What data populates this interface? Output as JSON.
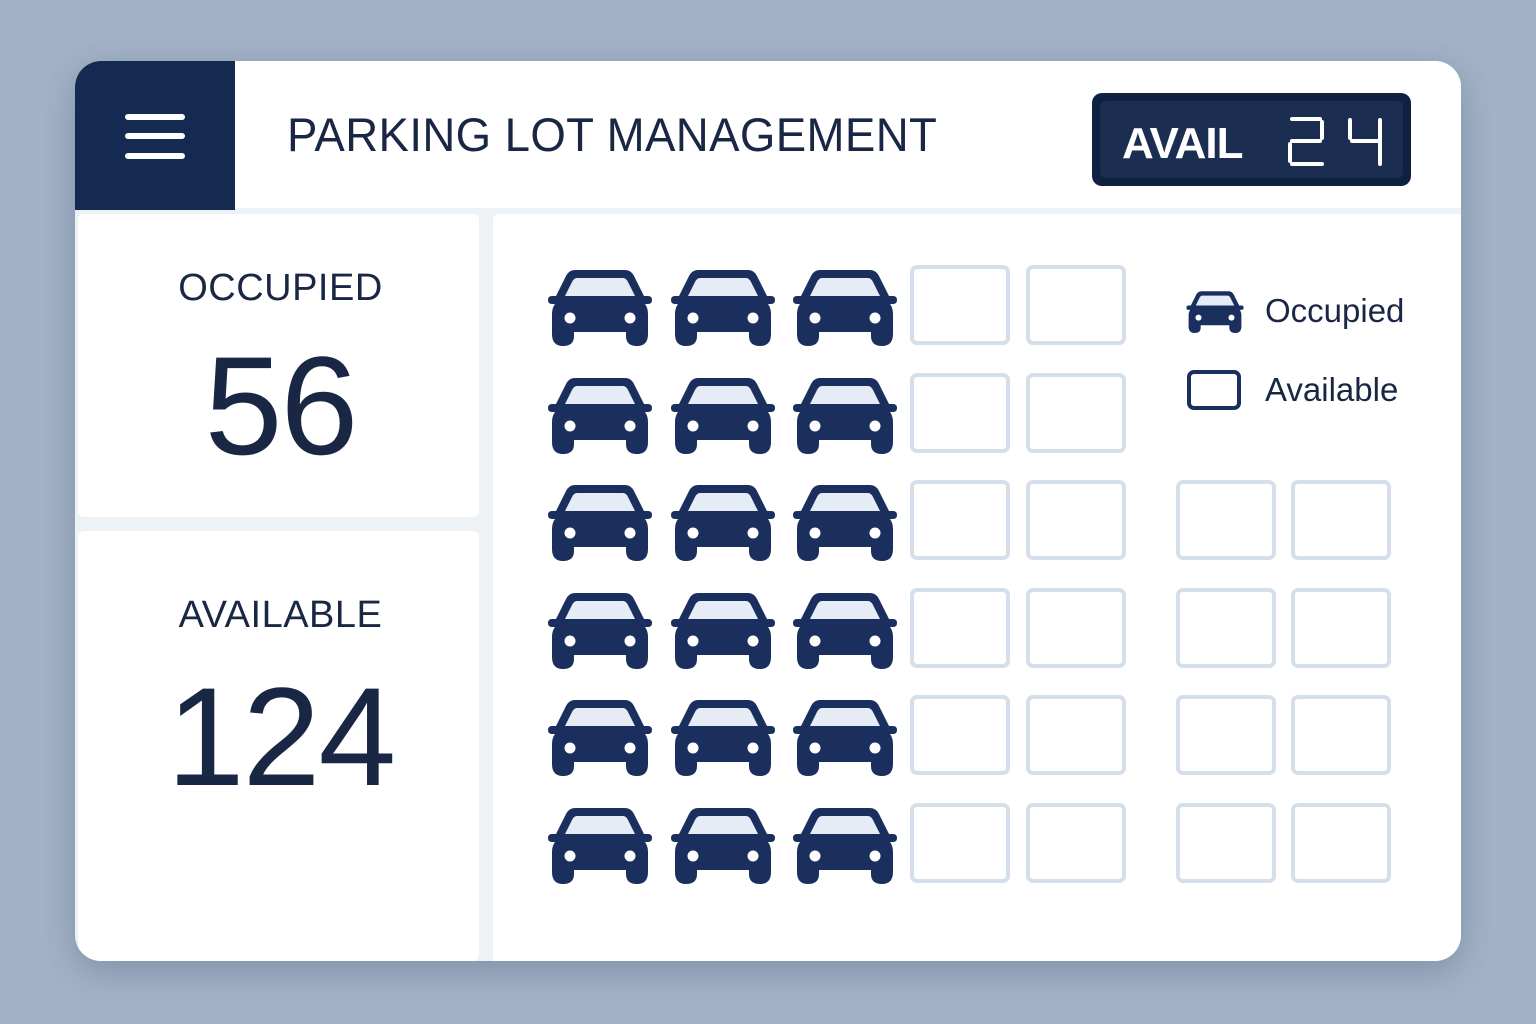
{
  "header": {
    "title": "PARKING LOT MANAGEMENT",
    "avail_label": "AVAIL",
    "avail_digits": "24"
  },
  "stats": {
    "occupied_label": "OCCUPIED",
    "occupied_value": "56",
    "available_label": "AVAILABLE",
    "available_value": "124"
  },
  "legend": {
    "occupied": "Occupied",
    "available": "Available"
  },
  "lot": {
    "rows": [
      [
        "occupied",
        "occupied",
        "occupied",
        "available",
        "available"
      ],
      [
        "occupied",
        "occupied",
        "occupied",
        "available",
        "available"
      ],
      [
        "occupied",
        "occupied",
        "occupied",
        "available",
        "available",
        "available",
        "available"
      ],
      [
        "occupied",
        "occupied",
        "occupied",
        "available",
        "available",
        "available",
        "available"
      ],
      [
        "occupied",
        "occupied",
        "occupied",
        "available",
        "available",
        "available",
        "available"
      ],
      [
        "occupied",
        "occupied",
        "occupied",
        "available",
        "available",
        "available",
        "available"
      ]
    ]
  },
  "colors": {
    "brand_navy": "#142a50",
    "car_fill": "#1a2f5e",
    "car_window": "#e6ecf5",
    "slot_border": "#d5dfec",
    "background": "#a3b2c6"
  },
  "icons": {
    "menu": "hamburger-menu-icon",
    "occupied": "car-icon",
    "available": "empty-slot-icon"
  }
}
